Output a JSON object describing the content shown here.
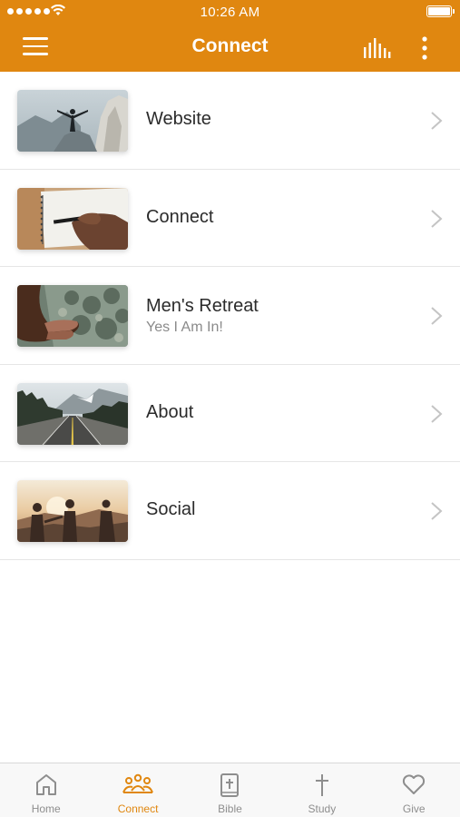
{
  "status": {
    "time": "10:26 AM"
  },
  "header": {
    "title": "Connect"
  },
  "colors": {
    "accent": "#e08710",
    "tab_inactive": "#8e8e8e",
    "subtitle": "#8a8a8a"
  },
  "items": [
    {
      "title": "Website",
      "subtitle": "",
      "image": "person-on-cliff"
    },
    {
      "title": "Connect",
      "subtitle": "",
      "image": "hand-writing-notebook"
    },
    {
      "title": "Men's Retreat",
      "subtitle": "Yes I Am In!",
      "image": "hands-over-landscape"
    },
    {
      "title": "About",
      "subtitle": "",
      "image": "mountain-road"
    },
    {
      "title": "Social",
      "subtitle": "",
      "image": "friends-at-sunset"
    }
  ],
  "tabs": [
    {
      "label": "Home",
      "icon": "home-icon",
      "active": false
    },
    {
      "label": "Connect",
      "icon": "people-icon",
      "active": true
    },
    {
      "label": "Bible",
      "icon": "bible-icon",
      "active": false
    },
    {
      "label": "Study",
      "icon": "cross-icon",
      "active": false
    },
    {
      "label": "Give",
      "icon": "heart-icon",
      "active": false
    }
  ]
}
